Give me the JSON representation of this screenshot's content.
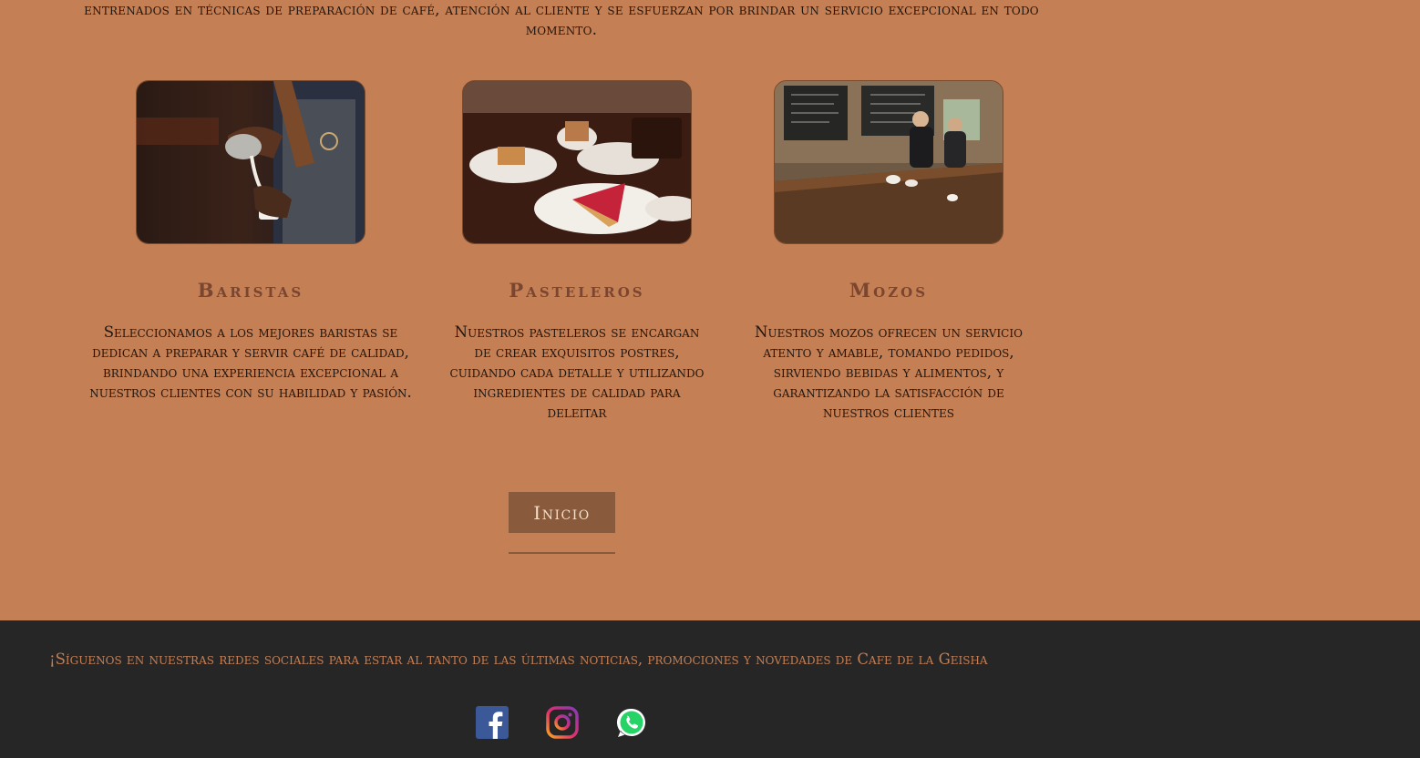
{
  "intro": {
    "text": "entrenados en técnicas de preparación de café, atención al cliente y se esfuerzan por brindar un servicio excepcional en todo momento."
  },
  "team": [
    {
      "title": "Baristas",
      "description": "Seleccionamos a los mejores baristas se dedican a preparar y servir café de calidad, brindando una experiencia excepcional a nuestros clientes con su habilidad y pasión."
    },
    {
      "title": "Pasteleros",
      "description": "Nuestros pasteleros se encargan de crear exquisitos postres, cuidando cada detalle y utilizando ingredientes de calidad para deleitar"
    },
    {
      "title": "Mozos",
      "description": "Nuestros mozos ofrecen un servicio atento y amable, tomando pedidos, sirviendo bebidas y alimentos, y garantizando la satisfacción de nuestros clientes"
    }
  ],
  "nav": {
    "inicio_label": "Inicio"
  },
  "footer": {
    "follow_text": "¡Síguenos en nuestras redes sociales para estar al tanto de las últimas noticias, promociones y novedades de Cafe de la Geisha",
    "social": [
      {
        "icon": "facebook-icon",
        "color": "#3b5998"
      },
      {
        "icon": "instagram-icon",
        "color": "#c13584"
      },
      {
        "icon": "whatsapp-icon",
        "color": "#25d366"
      }
    ]
  },
  "colors": {
    "background": "#c47f55",
    "footer": "#262626",
    "button": "#8a5a3c",
    "title": "#7a4630"
  }
}
